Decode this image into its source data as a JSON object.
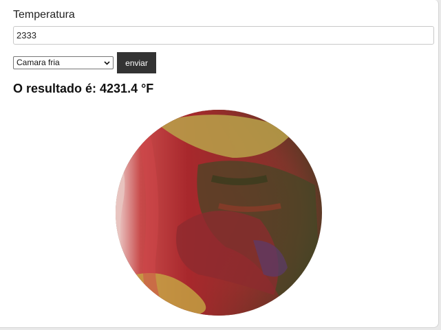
{
  "form": {
    "temperature_label": "Temperatura",
    "temperature_value": "2333",
    "location_selected": "Camara fria",
    "send_label": "enviar"
  },
  "result": {
    "text": "O resultado é: 4231.4 °F"
  },
  "image": {
    "subject": "raw meat photo",
    "palette": {
      "red": "#a8282c",
      "dark_green": "#3d4a25",
      "yellow": "#b9a24a",
      "pink": "#e8c4c0",
      "purple": "#5b3a6b"
    }
  },
  "icons": {
    "select_arrow": "chevron-down-icon"
  }
}
